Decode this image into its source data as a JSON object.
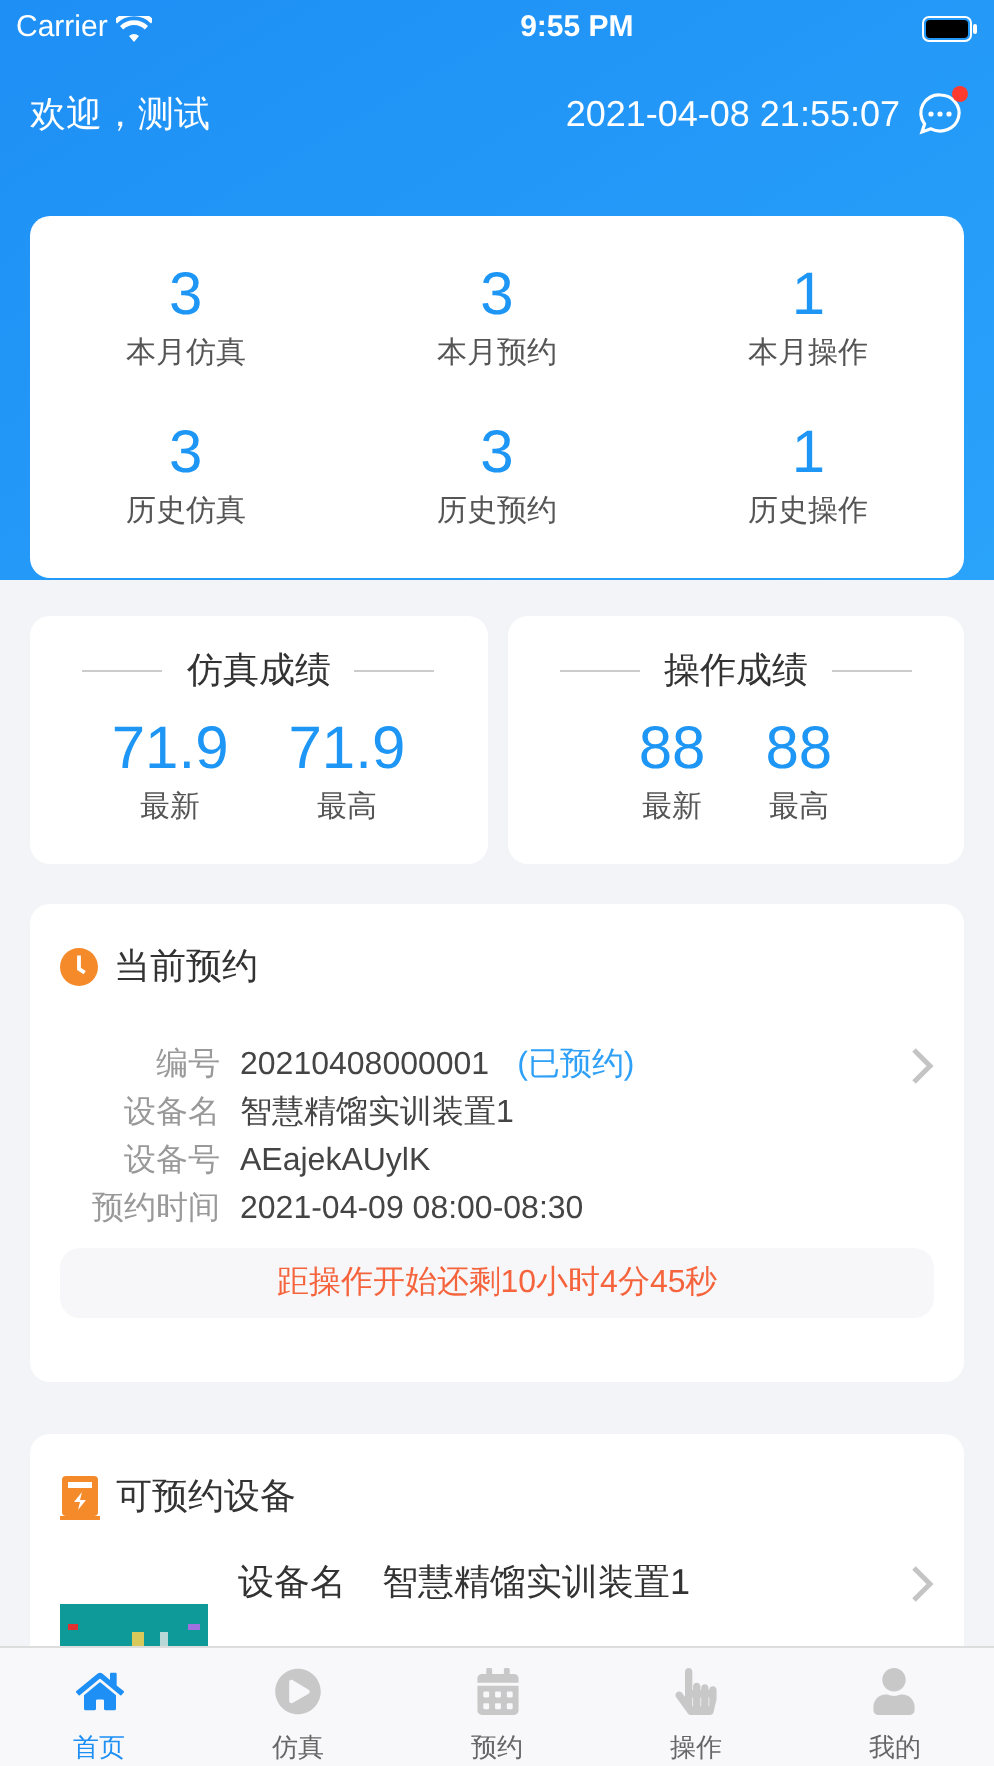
{
  "status_bar": {
    "carrier": "Carrier",
    "time": "9:55 PM"
  },
  "header": {
    "greeting": "欢迎，测试",
    "datetime": "2021-04-08 21:55:07",
    "has_unread": true
  },
  "stats": [
    {
      "value": "3",
      "label": "本月仿真"
    },
    {
      "value": "3",
      "label": "本月预约"
    },
    {
      "value": "1",
      "label": "本月操作"
    },
    {
      "value": "3",
      "label": "历史仿真"
    },
    {
      "value": "3",
      "label": "历史预约"
    },
    {
      "value": "1",
      "label": "历史操作"
    }
  ],
  "scores": [
    {
      "title": "仿真成绩",
      "items": [
        {
          "value": "71.9",
          "label": "最新"
        },
        {
          "value": "71.9",
          "label": "最高"
        }
      ]
    },
    {
      "title": "操作成绩",
      "items": [
        {
          "value": "88",
          "label": "最新"
        },
        {
          "value": "88",
          "label": "最高"
        }
      ]
    }
  ],
  "current_booking": {
    "title": "当前预约",
    "fields": [
      {
        "label": "编号",
        "value": "20210408000001",
        "status": "(已预约)"
      },
      {
        "label": "设备名",
        "value": "智慧精馏实训装置1"
      },
      {
        "label": "设备号",
        "value": "AEajekAUylK"
      },
      {
        "label": "预约时间",
        "value": "2021-04-09 08:00-08:30"
      }
    ],
    "countdown": "距操作开始还剩10小时4分45秒"
  },
  "devices": {
    "title": "可预约设备",
    "items": [
      {
        "fields": [
          {
            "label": "设备名",
            "value": "智慧精馏实训装置1"
          }
        ]
      }
    ]
  },
  "tab_bar": [
    {
      "label": "首页",
      "kind": "home",
      "selected": true
    },
    {
      "label": "仿真",
      "kind": "play",
      "selected": false
    },
    {
      "label": "预约",
      "kind": "calendar",
      "selected": false
    },
    {
      "label": "操作",
      "kind": "hand",
      "selected": false
    },
    {
      "label": "我的",
      "kind": "user",
      "selected": false
    }
  ]
}
